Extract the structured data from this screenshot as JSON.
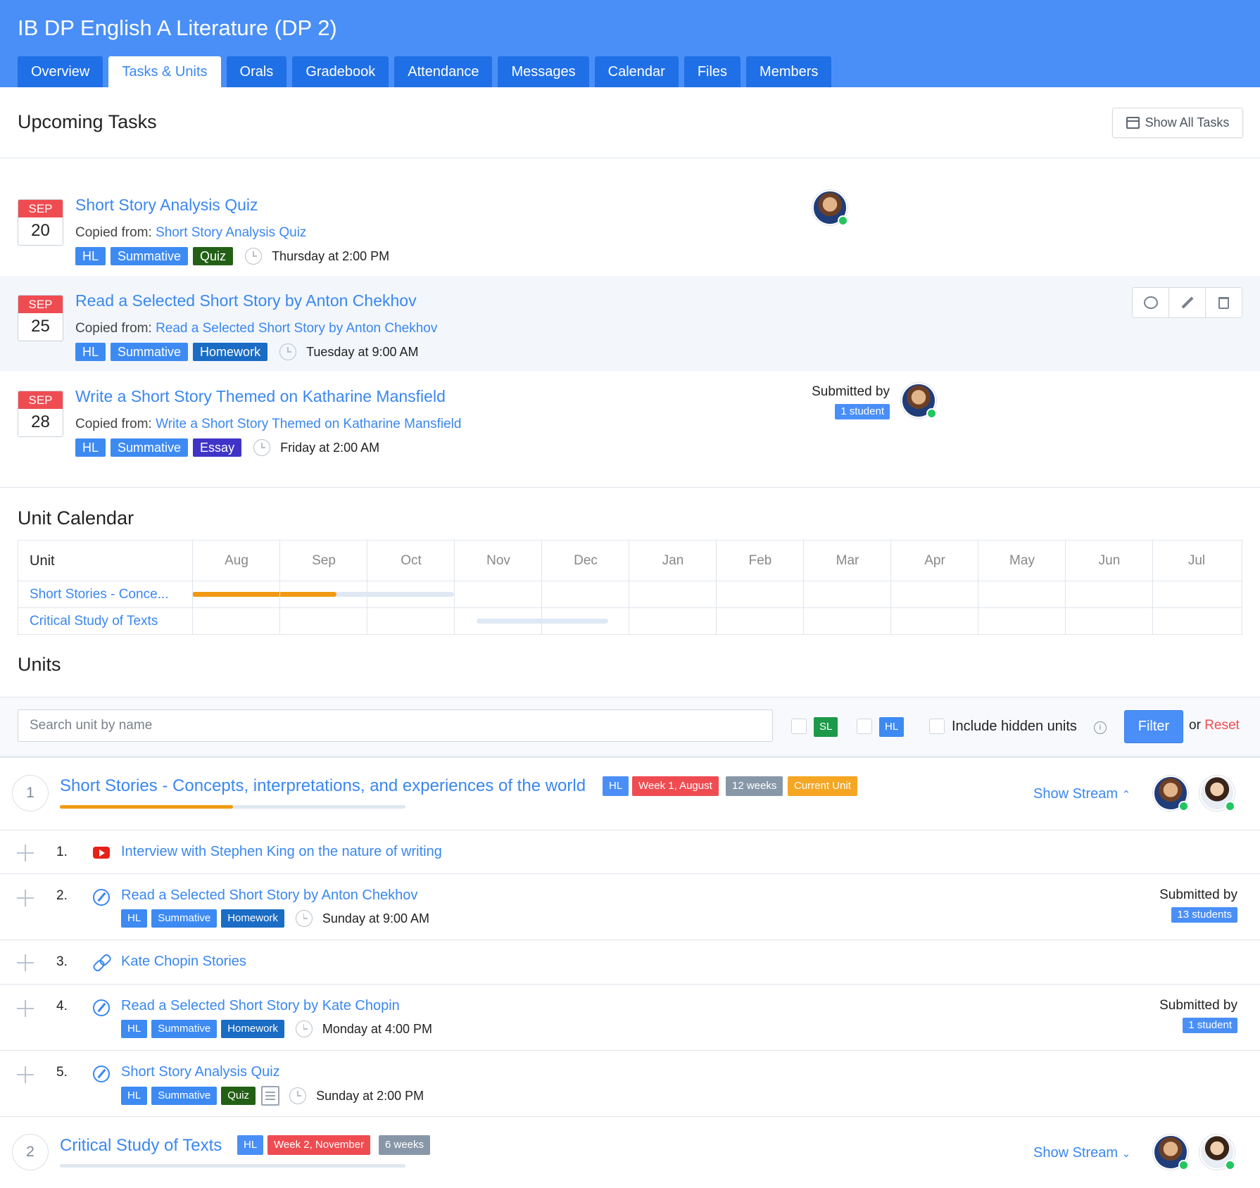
{
  "header": {
    "course_title": "IB DP English A Literature (DP 2)",
    "tabs": [
      {
        "label": "Overview",
        "active": false
      },
      {
        "label": "Tasks & Units",
        "active": true
      },
      {
        "label": "Orals",
        "active": false
      },
      {
        "label": "Gradebook",
        "active": false
      },
      {
        "label": "Attendance",
        "active": false
      },
      {
        "label": "Messages",
        "active": false
      },
      {
        "label": "Calendar",
        "active": false
      },
      {
        "label": "Files",
        "active": false
      },
      {
        "label": "Members",
        "active": false
      }
    ]
  },
  "upcoming": {
    "heading": "Upcoming Tasks",
    "show_all_label": "Show All Tasks",
    "copied_prefix": "Copied from:",
    "tasks": [
      {
        "month": "SEP",
        "day": "20",
        "title": "Short Story Analysis Quiz",
        "copied_from": "Short Story Analysis Quiz",
        "tags": [
          "HL",
          "Summative",
          "Quiz"
        ],
        "due": "Thursday at 2:00 PM"
      },
      {
        "month": "SEP",
        "day": "25",
        "title": "Read a Selected Short Story by Anton Chekhov",
        "copied_from": "Read a Selected Short Story by Anton Chekhov",
        "tags": [
          "HL",
          "Summative",
          "Homework"
        ],
        "due": "Tuesday at 9:00 AM"
      },
      {
        "month": "SEP",
        "day": "28",
        "title": "Write a Short Story Themed on Katharine Mansfield",
        "copied_from": "Write a Short Story Themed on Katharine Mansfield",
        "tags": [
          "HL",
          "Summative",
          "Essay"
        ],
        "due": "Friday at 2:00 AM",
        "submitted_label": "Submitted by",
        "submitted_count": "1 student"
      }
    ]
  },
  "unit_calendar": {
    "heading": "Unit Calendar",
    "unit_col": "Unit",
    "months": [
      "Aug",
      "Sep",
      "Oct",
      "Nov",
      "Dec",
      "Jan",
      "Feb",
      "Mar",
      "Apr",
      "May",
      "Jun",
      "Jul"
    ],
    "rows": [
      {
        "label": "Short Stories - Conce...",
        "progress": 0.55
      },
      {
        "label": "Critical Study of Texts",
        "progress": 0
      }
    ]
  },
  "units": {
    "heading": "Units",
    "search_placeholder": "Search unit by name",
    "sl_label": "SL",
    "hl_label": "HL",
    "hidden_label": "Include hidden units",
    "info_glyph": "i",
    "filter_label": "Filter",
    "or_label": "or",
    "reset_label": "Reset",
    "show_stream_label": "Show Stream",
    "list": [
      {
        "number": "1",
        "title": "Short Stories - Concepts, interpretations, and experiences of the world",
        "progress": 0.5,
        "tags": [
          "HL",
          "Week 1, August",
          "12 weeks",
          "Current Unit"
        ],
        "items": [
          {
            "number": "1.",
            "type": "youtube-icon",
            "title": "Interview with Stephen King on the nature of writing"
          },
          {
            "number": "2.",
            "type": "task-icon",
            "title": "Read a Selected Short Story by Anton Chekhov",
            "tags": [
              "HL",
              "Summative",
              "Homework"
            ],
            "due": "Sunday at 9:00 AM",
            "submitted_label": "Submitted by",
            "submitted_count": "13 students"
          },
          {
            "number": "3.",
            "type": "link-icon",
            "title": "Kate Chopin Stories"
          },
          {
            "number": "4.",
            "type": "task-icon",
            "title": "Read a Selected Short Story by Kate Chopin",
            "tags": [
              "HL",
              "Summative",
              "Homework"
            ],
            "due": "Monday at 4:00 PM",
            "submitted_label": "Submitted by",
            "submitted_count": "1 student"
          },
          {
            "number": "5.",
            "type": "task-icon",
            "title": "Short Story Analysis Quiz",
            "tags": [
              "HL",
              "Summative",
              "Quiz"
            ],
            "due": "Sunday at 2:00 PM"
          }
        ]
      },
      {
        "number": "2",
        "title": "Critical Study of Texts",
        "progress": 0,
        "tags": [
          "HL",
          "Week 2, November",
          "6 weeks"
        ]
      }
    ]
  },
  "colors": {
    "header_blue": "#4a8ff7",
    "tab_blue": "#1f6fe6",
    "link_blue": "#3a87f0",
    "date_red": "#ef4c52",
    "progress_orange": "#f09a13",
    "online_green": "#22c55e"
  }
}
